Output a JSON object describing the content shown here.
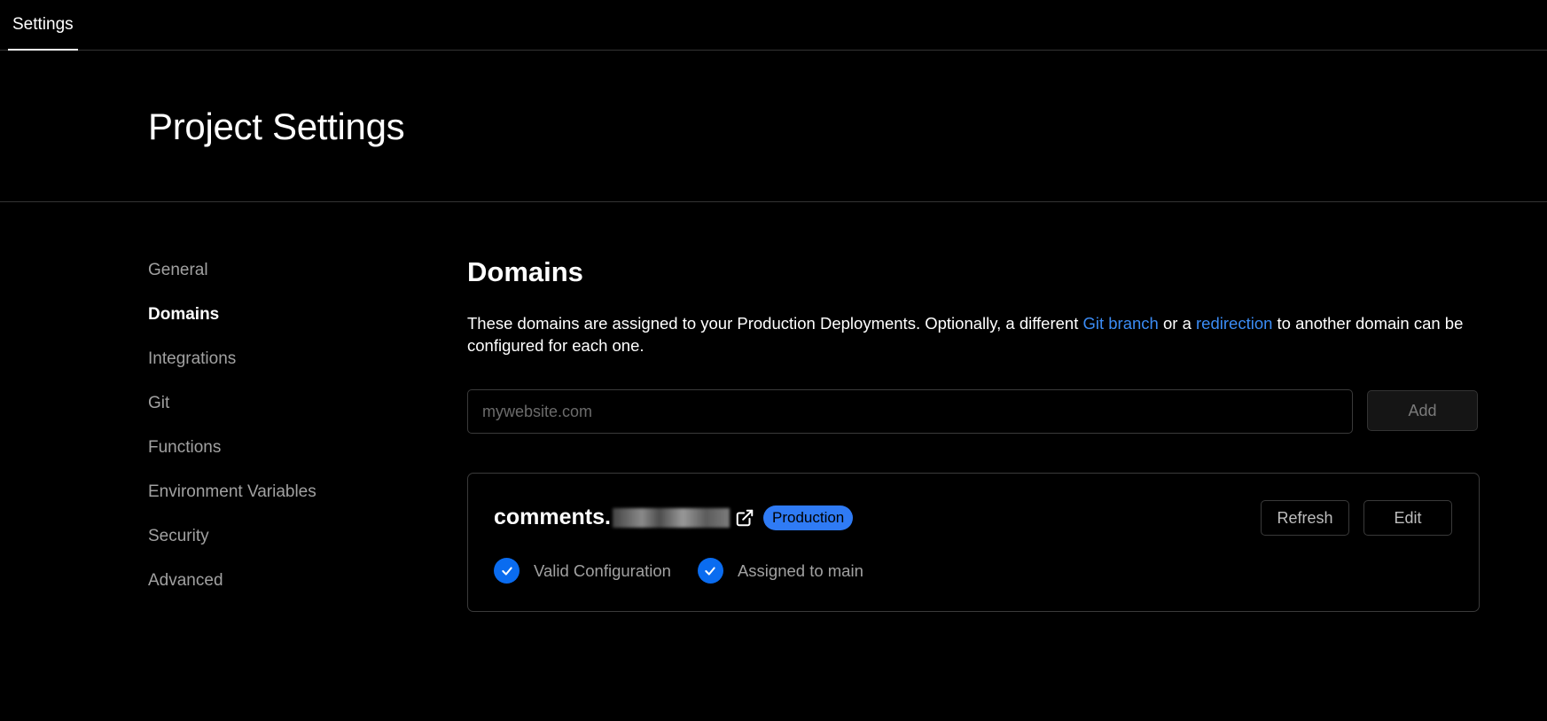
{
  "topbar": {
    "tab_label": "Settings"
  },
  "header": {
    "title": "Project Settings"
  },
  "sidebar": {
    "items": [
      {
        "label": "General"
      },
      {
        "label": "Domains"
      },
      {
        "label": "Integrations"
      },
      {
        "label": "Git"
      },
      {
        "label": "Functions"
      },
      {
        "label": "Environment Variables"
      },
      {
        "label": "Security"
      },
      {
        "label": "Advanced"
      }
    ],
    "active": "Domains"
  },
  "domains": {
    "title": "Domains",
    "description_part1": "These domains are assigned to your Production Deployments. Optionally, a different ",
    "link_git_branch": "Git branch",
    "description_part2": " or a ",
    "link_redirection": "redirection",
    "description_part3": " to another domain can be configured for each one.",
    "input_placeholder": "mywebsite.com",
    "input_value": "",
    "add_label": "Add",
    "card": {
      "domain_prefix": "comments.",
      "badge": "Production",
      "refresh_label": "Refresh",
      "edit_label": "Edit",
      "status_valid": "Valid Configuration",
      "status_assigned": "Assigned to main"
    }
  },
  "colors": {
    "background": "#000000",
    "link": "#3b8cf5",
    "badge": "#2f7bf5",
    "check": "#0a6cf0"
  }
}
